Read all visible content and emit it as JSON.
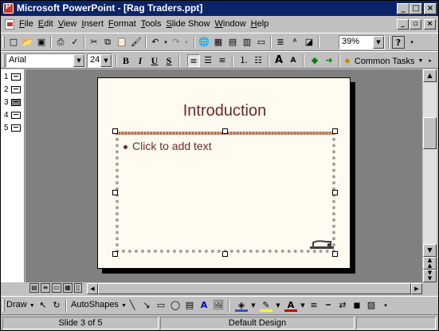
{
  "window": {
    "title": "Microsoft PowerPoint - [Rag Traders.ppt]",
    "minimize_label": "_",
    "maximize_label": "□",
    "close_label": "×"
  },
  "menu": {
    "items": [
      "File",
      "Edit",
      "View",
      "Insert",
      "Format",
      "Tools",
      "Slide Show",
      "Window",
      "Help"
    ],
    "doc_minimize": "_",
    "doc_restore": "▫",
    "doc_close": "×"
  },
  "standard_toolbar": {
    "zoom": "39%",
    "help_icon": "?"
  },
  "format_toolbar": {
    "font": "Arial",
    "font_size": "24",
    "bold": "B",
    "italic": "I",
    "underline": "U",
    "shadow": "S",
    "common_tasks": "Common Tasks"
  },
  "outline": {
    "slides": [
      "1",
      "2",
      "3",
      "4",
      "5"
    ],
    "selected_index": 2
  },
  "slide": {
    "title": "Introduction",
    "placeholder": "Click to add text"
  },
  "draw_toolbar": {
    "draw_label": "Draw",
    "autoshapes_label": "AutoShapes"
  },
  "status": {
    "slide_position": "Slide 3 of 5",
    "design": "Default Design"
  },
  "colors": {
    "title_bar": "#0a246a",
    "slide_text": "#6b2a2a",
    "slide_bg": "#fffbf0",
    "fill_color": "#3355cc",
    "line_color": "#ffff00",
    "font_color": "#cc0000"
  }
}
